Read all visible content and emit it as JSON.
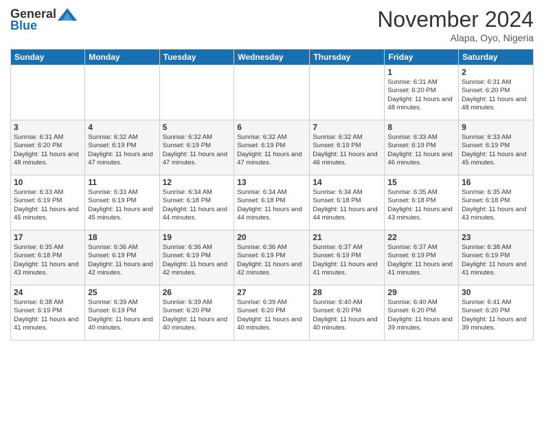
{
  "header": {
    "logo_text_general": "General",
    "logo_text_blue": "Blue",
    "month_title": "November 2024",
    "location": "Alapa, Oyo, Nigeria"
  },
  "calendar": {
    "days_of_week": [
      "Sunday",
      "Monday",
      "Tuesday",
      "Wednesday",
      "Thursday",
      "Friday",
      "Saturday"
    ],
    "weeks": [
      [
        {
          "day": "",
          "info": ""
        },
        {
          "day": "",
          "info": ""
        },
        {
          "day": "",
          "info": ""
        },
        {
          "day": "",
          "info": ""
        },
        {
          "day": "",
          "info": ""
        },
        {
          "day": "1",
          "info": "Sunrise: 6:31 AM\nSunset: 6:20 PM\nDaylight: 11 hours and 48 minutes."
        },
        {
          "day": "2",
          "info": "Sunrise: 6:31 AM\nSunset: 6:20 PM\nDaylight: 11 hours and 48 minutes."
        }
      ],
      [
        {
          "day": "3",
          "info": "Sunrise: 6:31 AM\nSunset: 6:20 PM\nDaylight: 11 hours and 48 minutes."
        },
        {
          "day": "4",
          "info": "Sunrise: 6:32 AM\nSunset: 6:19 PM\nDaylight: 11 hours and 47 minutes."
        },
        {
          "day": "5",
          "info": "Sunrise: 6:32 AM\nSunset: 6:19 PM\nDaylight: 11 hours and 47 minutes."
        },
        {
          "day": "6",
          "info": "Sunrise: 6:32 AM\nSunset: 6:19 PM\nDaylight: 11 hours and 47 minutes."
        },
        {
          "day": "7",
          "info": "Sunrise: 6:32 AM\nSunset: 6:19 PM\nDaylight: 11 hours and 46 minutes."
        },
        {
          "day": "8",
          "info": "Sunrise: 6:33 AM\nSunset: 6:19 PM\nDaylight: 11 hours and 46 minutes."
        },
        {
          "day": "9",
          "info": "Sunrise: 6:33 AM\nSunset: 6:19 PM\nDaylight: 11 hours and 45 minutes."
        }
      ],
      [
        {
          "day": "10",
          "info": "Sunrise: 6:33 AM\nSunset: 6:19 PM\nDaylight: 11 hours and 45 minutes."
        },
        {
          "day": "11",
          "info": "Sunrise: 6:33 AM\nSunset: 6:19 PM\nDaylight: 11 hours and 45 minutes."
        },
        {
          "day": "12",
          "info": "Sunrise: 6:34 AM\nSunset: 6:18 PM\nDaylight: 11 hours and 44 minutes."
        },
        {
          "day": "13",
          "info": "Sunrise: 6:34 AM\nSunset: 6:18 PM\nDaylight: 11 hours and 44 minutes."
        },
        {
          "day": "14",
          "info": "Sunrise: 6:34 AM\nSunset: 6:18 PM\nDaylight: 11 hours and 44 minutes."
        },
        {
          "day": "15",
          "info": "Sunrise: 6:35 AM\nSunset: 6:18 PM\nDaylight: 11 hours and 43 minutes."
        },
        {
          "day": "16",
          "info": "Sunrise: 6:35 AM\nSunset: 6:18 PM\nDaylight: 11 hours and 43 minutes."
        }
      ],
      [
        {
          "day": "17",
          "info": "Sunrise: 6:35 AM\nSunset: 6:18 PM\nDaylight: 11 hours and 43 minutes."
        },
        {
          "day": "18",
          "info": "Sunrise: 6:36 AM\nSunset: 6:19 PM\nDaylight: 11 hours and 42 minutes."
        },
        {
          "day": "19",
          "info": "Sunrise: 6:36 AM\nSunset: 6:19 PM\nDaylight: 11 hours and 42 minutes."
        },
        {
          "day": "20",
          "info": "Sunrise: 6:36 AM\nSunset: 6:19 PM\nDaylight: 11 hours and 42 minutes."
        },
        {
          "day": "21",
          "info": "Sunrise: 6:37 AM\nSunset: 6:19 PM\nDaylight: 11 hours and 41 minutes."
        },
        {
          "day": "22",
          "info": "Sunrise: 6:37 AM\nSunset: 6:19 PM\nDaylight: 11 hours and 41 minutes."
        },
        {
          "day": "23",
          "info": "Sunrise: 6:38 AM\nSunset: 6:19 PM\nDaylight: 11 hours and 41 minutes."
        }
      ],
      [
        {
          "day": "24",
          "info": "Sunrise: 6:38 AM\nSunset: 6:19 PM\nDaylight: 11 hours and 41 minutes."
        },
        {
          "day": "25",
          "info": "Sunrise: 6:39 AM\nSunset: 6:19 PM\nDaylight: 11 hours and 40 minutes."
        },
        {
          "day": "26",
          "info": "Sunrise: 6:39 AM\nSunset: 6:20 PM\nDaylight: 11 hours and 40 minutes."
        },
        {
          "day": "27",
          "info": "Sunrise: 6:39 AM\nSunset: 6:20 PM\nDaylight: 11 hours and 40 minutes."
        },
        {
          "day": "28",
          "info": "Sunrise: 6:40 AM\nSunset: 6:20 PM\nDaylight: 11 hours and 40 minutes."
        },
        {
          "day": "29",
          "info": "Sunrise: 6:40 AM\nSunset: 6:20 PM\nDaylight: 11 hours and 39 minutes."
        },
        {
          "day": "30",
          "info": "Sunrise: 6:41 AM\nSunset: 6:20 PM\nDaylight: 11 hours and 39 minutes."
        }
      ]
    ]
  }
}
